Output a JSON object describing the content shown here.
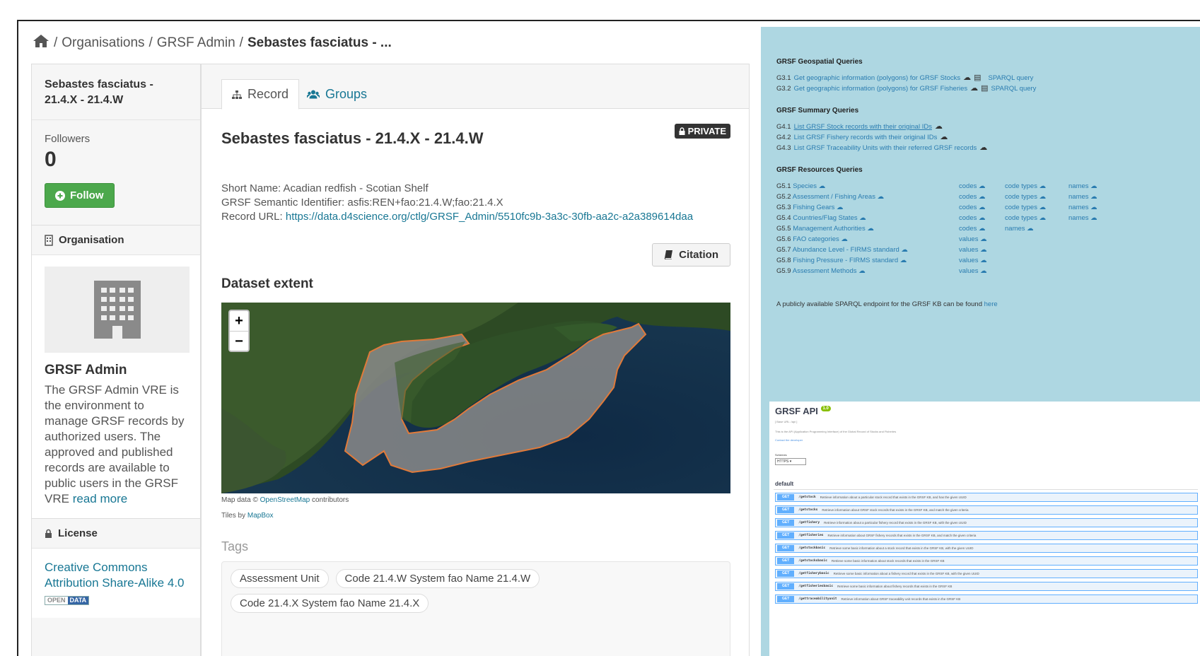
{
  "breadcrumb": {
    "sep1": "/",
    "item1": "Organisations",
    "sep2": "/",
    "item2": "GRSF Admin",
    "sep3": "/",
    "current": "Sebastes fasciatus - ..."
  },
  "sidebar": {
    "dataset_title": "Sebastes fasciatus - 21.4.X - 21.4.W",
    "followers_label": "Followers",
    "followers_count": "0",
    "follow_button": "Follow",
    "organisation_heading": "Organisation",
    "org_name": "GRSF Admin",
    "org_description": "The GRSF Admin VRE is the environment to manage GRSF records by authorized users. The approved and published records are available to public users in the GRSF VRE",
    "read_more": "read more",
    "license_heading": "License",
    "license_link": "Creative Commons Attribution Share-Alike 4.0",
    "od_left": "OPEN",
    "od_right": "DATA"
  },
  "tabs": {
    "record": "Record",
    "groups": "Groups"
  },
  "record": {
    "title": "Sebastes fasciatus - 21.4.X - 21.4.W",
    "private_badge": "PRIVATE",
    "short_name": "Short Name: Acadian redfish - Scotian Shelf",
    "semantic_id": "GRSF Semantic Identifier: asfis:REN+fao:21.4.W;fao:21.4.X",
    "url_label": "Record URL:",
    "url": "https://data.d4science.org/ctlg/GRSF_Admin/5510fc9b-3a3c-30fb-aa2c-a2a389614daa",
    "citation_button": "Citation",
    "extent_heading": "Dataset extent",
    "zoom_in": "+",
    "zoom_out": "−",
    "map_attr_prefix": "Map data ©",
    "map_attr_link": "OpenStreetMap",
    "map_attr_suffix": "contributors",
    "tiles_prefix": "Tiles by",
    "tiles_link": "MapBox",
    "tags_heading": "Tags",
    "tags": [
      "Assessment Unit",
      "Code 21.4.W System fao Name 21.4.W",
      "Code 21.4.X System fao Name 21.4.X"
    ]
  },
  "queries": {
    "geo_heading": "GRSF Geospatial Queries",
    "geo": [
      {
        "n": "G3.1",
        "text": "Get geographic information (polygons) for GRSF Stocks",
        "sparql": "SPARQL query"
      },
      {
        "n": "G3.2",
        "text": "Get geographic information (polygons) for GRSF Fisheries",
        "sparql": "SPARQL query"
      }
    ],
    "summary_heading": "GRSF Summary Queries",
    "summary": [
      {
        "n": "G4.1",
        "text": "List GRSF Stock records with their original IDs"
      },
      {
        "n": "G4.2",
        "text": "List GRSF Fishery records with their original IDs"
      },
      {
        "n": "G4.3",
        "text": "List GRSF Traceability Units with their referred GRSF records"
      }
    ],
    "resources_heading": "GRSF Resources Queries",
    "resources": [
      {
        "n": "G5.1",
        "text": "Species",
        "c2": "codes",
        "c3": "code types",
        "c4": "names"
      },
      {
        "n": "G5.2",
        "text": "Assessment / Fishing Areas",
        "c2": "codes",
        "c3": "code types",
        "c4": "names"
      },
      {
        "n": "G5.3",
        "text": "Fishing Gears",
        "c2": "codes",
        "c3": "code types",
        "c4": "names"
      },
      {
        "n": "G5.4",
        "text": "Countries/Flag States",
        "c2": "codes",
        "c3": "code types",
        "c4": "names"
      },
      {
        "n": "G5.5",
        "text": "Management Authorities",
        "c2": "codes",
        "c3": "names",
        "c4": ""
      },
      {
        "n": "G5.6",
        "text": "FAO categories",
        "c2": "values",
        "c3": "",
        "c4": ""
      },
      {
        "n": "G5.7",
        "text": "Abundance Level - FIRMS standard",
        "c2": "values",
        "c3": "",
        "c4": ""
      },
      {
        "n": "G5.8",
        "text": "Fishing Pressure - FIRMS standard",
        "c2": "values",
        "c3": "",
        "c4": ""
      },
      {
        "n": "G5.9",
        "text": "Assessment Methods",
        "c2": "values",
        "c3": "",
        "c4": ""
      }
    ],
    "endpoint_note": "A publicly available SPARQL endpoint for the GRSF KB can be found",
    "endpoint_link": "here"
  },
  "api": {
    "title": "GRSF API",
    "version": "1.0",
    "base_url": "[ Base URL: /api ]",
    "description": "This is the API (Application Programming Interface) of the Global Record of Stocks and Fisheries",
    "contact": "Contact the developer",
    "schemes_label": "Schemes",
    "scheme": "HTTPS",
    "section": "default",
    "ops": [
      {
        "method": "GET",
        "path": "/getstock",
        "desc": "Retrieve information about a particular stock record that exists in the GRSF KB, and has the given UUID"
      },
      {
        "method": "GET",
        "path": "/getstocks",
        "desc": "Retrieve information about GRSF stock records that exists in the GRSF KB, and match the given criteria"
      },
      {
        "method": "GET",
        "path": "/getfishery",
        "desc": "Retrieve information about a particular fishery record that exists in the GRSF KB, with the given UUID"
      },
      {
        "method": "GET",
        "path": "/getfisheries",
        "desc": "Retrieve information about GRSF fishery records that exists in the GRSF KB, and match the given criteria"
      },
      {
        "method": "GET",
        "path": "/getstockbasic",
        "desc": "Retrieve some basic information about a stock record that exists in the GRSF KB, with the given UUID"
      },
      {
        "method": "GET",
        "path": "/getstocksbasic",
        "desc": "Retrieve some basic information about stock records that exists in the GRSF KB"
      },
      {
        "method": "GET",
        "path": "/getfisherybasic",
        "desc": "Retrieve some basic information about a fishery record that exists in the GRSF KB, with the given UUID"
      },
      {
        "method": "GET",
        "path": "/getfisheriesbasic",
        "desc": "Retrieve some basic information about fishery records that exists in the GRSF KB"
      },
      {
        "method": "GET",
        "path": "/gettraceabilityunit",
        "desc": "Retrieve information about GRSF traceability unit records that exists in the GRSF KB"
      }
    ]
  }
}
